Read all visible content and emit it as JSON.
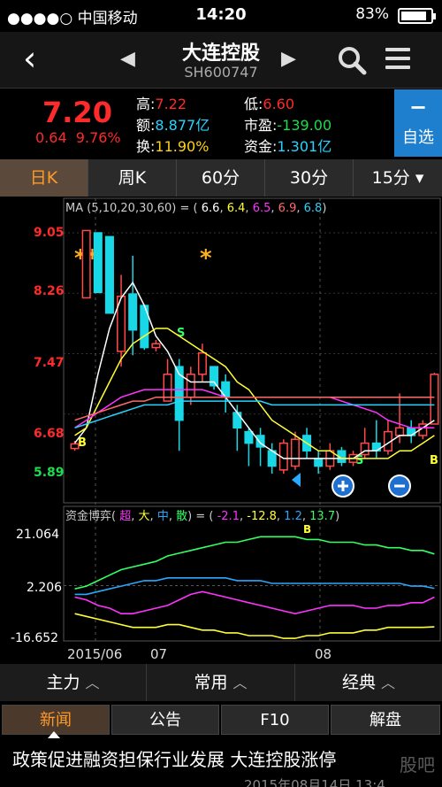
{
  "status_bar": {
    "carrier": "●●●●○ 中国移动",
    "time": "14:20",
    "battery": "83%"
  },
  "nav": {
    "title": "大连控股",
    "code": "SH600747"
  },
  "quote": {
    "price": "7.20",
    "change": "0.64",
    "change_pct": "9.76%",
    "high_label": "高:",
    "high": "7.22",
    "low_label": "低:",
    "low": "6.60",
    "amount_label": "额:",
    "amount": "8.877亿",
    "pe_label": "市盈:",
    "pe": "-139.00",
    "turnover_label": "换:",
    "turnover": "11.90%",
    "capital_label": "资金:",
    "capital": "1.301亿"
  },
  "add_watchlist": {
    "symbol": "−",
    "label": "自选"
  },
  "period_tabs": [
    "日K",
    "周K",
    "60分",
    "30分",
    "15分 ▾"
  ],
  "ma_header": {
    "label": "MA",
    "params": "(5,10,20,30,60)",
    "values": [
      "6.6",
      "6.4",
      "6.5",
      "6.9",
      "6.8"
    ],
    "colors": [
      "#ffffff",
      "#ffff33",
      "#ff33ff",
      "#33ff66",
      "#29d3ff"
    ]
  },
  "sub_header": {
    "label": "资金博弈",
    "names": [
      "超",
      "大",
      "中",
      "散"
    ],
    "values": [
      "-2.1",
      "-12.8",
      "1.2",
      "13.7"
    ],
    "colors": [
      "#ff33ff",
      "#ffff33",
      "#29a8ff",
      "#33ff66"
    ]
  },
  "chart_data": {
    "type": "candlestick",
    "price_ticks": [
      "9.05",
      "8.26",
      "7.47",
      "6.68",
      "5.89"
    ],
    "price_range": [
      5.89,
      9.05
    ],
    "sub_ticks": [
      "21.064",
      "2.206",
      "-16.652"
    ],
    "sub_range": [
      -16.652,
      21.064
    ],
    "x_labels": [
      "2015/06",
      "07",
      "08"
    ],
    "annotations": [
      "**",
      "*",
      "S",
      "S",
      "B",
      "B",
      "B"
    ],
    "candles": [
      {
        "o": 6.23,
        "c": 6.29,
        "h": 6.33,
        "l": 6.2
      },
      {
        "o": 8.2,
        "c": 9.08,
        "h": 9.08,
        "l": 8.2
      },
      {
        "o": 9.05,
        "c": 8.27,
        "h": 9.05,
        "l": 8.27
      },
      {
        "o": 9.0,
        "c": 8.0,
        "h": 9.0,
        "l": 8.0
      },
      {
        "o": 7.5,
        "c": 8.22,
        "h": 8.5,
        "l": 7.3
      },
      {
        "o": 8.25,
        "c": 7.78,
        "h": 8.75,
        "l": 7.45
      },
      {
        "o": 8.1,
        "c": 7.55,
        "h": 8.1,
        "l": 7.52
      },
      {
        "o": 7.55,
        "c": 7.6,
        "h": 7.65,
        "l": 7.5
      },
      {
        "o": 6.85,
        "c": 7.2,
        "h": 7.4,
        "l": 6.85
      },
      {
        "o": 7.3,
        "c": 6.6,
        "h": 7.4,
        "l": 6.2
      },
      {
        "o": 6.9,
        "c": 7.2,
        "h": 7.3,
        "l": 6.8
      },
      {
        "o": 7.2,
        "c": 7.48,
        "h": 7.6,
        "l": 7.1
      },
      {
        "o": 7.3,
        "c": 7.05,
        "h": 7.3,
        "l": 7.0
      },
      {
        "o": 7.1,
        "c": 6.9,
        "h": 7.2,
        "l": 6.7
      },
      {
        "o": 6.7,
        "c": 6.5,
        "h": 6.8,
        "l": 6.2
      },
      {
        "o": 6.45,
        "c": 6.3,
        "h": 6.5,
        "l": 6.0
      },
      {
        "o": 6.4,
        "c": 6.25,
        "h": 6.5,
        "l": 6.0
      },
      {
        "o": 6.2,
        "c": 6.0,
        "h": 6.3,
        "l": 5.9
      },
      {
        "o": 5.95,
        "c": 6.3,
        "h": 6.35,
        "l": 5.9
      },
      {
        "o": 6.0,
        "c": 6.35,
        "h": 6.45,
        "l": 5.95
      },
      {
        "o": 6.4,
        "c": 6.2,
        "h": 6.5,
        "l": 6.1
      },
      {
        "o": 6.1,
        "c": 6.0,
        "h": 6.2,
        "l": 5.9
      },
      {
        "o": 6.0,
        "c": 6.2,
        "h": 6.3,
        "l": 5.95
      },
      {
        "o": 6.2,
        "c": 6.05,
        "h": 6.25,
        "l": 6.0
      },
      {
        "o": 6.05,
        "c": 6.15,
        "h": 6.2,
        "l": 6.0
      },
      {
        "o": 6.15,
        "c": 6.3,
        "h": 6.5,
        "l": 6.1
      },
      {
        "o": 6.3,
        "c": 6.2,
        "h": 6.6,
        "l": 6.1
      },
      {
        "o": 6.2,
        "c": 6.45,
        "h": 6.6,
        "l": 6.15
      },
      {
        "o": 6.4,
        "c": 6.5,
        "h": 6.95,
        "l": 6.3
      },
      {
        "o": 6.5,
        "c": 6.4,
        "h": 6.6,
        "l": 6.3
      },
      {
        "o": 6.4,
        "c": 6.55,
        "h": 6.6,
        "l": 6.35
      },
      {
        "o": 6.55,
        "c": 7.2,
        "h": 7.22,
        "l": 6.55
      }
    ],
    "ma_lines": [
      {
        "name": "MA5",
        "values": [
          6.3,
          6.5,
          7.2,
          7.8,
          8.2,
          8.4,
          8.1,
          7.7,
          7.5,
          7.2,
          7.1,
          7.1,
          7.1,
          6.9,
          6.7,
          6.5,
          6.3,
          6.2,
          6.1,
          6.1,
          6.1,
          6.1,
          6.1,
          6.1,
          6.1,
          6.2,
          6.2,
          6.3,
          6.4,
          6.4,
          6.5,
          6.6
        ]
      },
      {
        "name": "MA10",
        "values": [
          6.4,
          6.5,
          6.8,
          7.1,
          7.4,
          7.6,
          7.7,
          7.8,
          7.8,
          7.7,
          7.6,
          7.5,
          7.4,
          7.3,
          7.1,
          7.0,
          6.8,
          6.6,
          6.5,
          6.4,
          6.3,
          6.2,
          6.2,
          6.1,
          6.1,
          6.1,
          6.1,
          6.1,
          6.2,
          6.2,
          6.3,
          6.4
        ]
      },
      {
        "name": "MA20",
        "values": [
          6.5,
          6.6,
          6.7,
          6.8,
          6.9,
          6.95,
          7.0,
          7.0,
          7.0,
          7.0,
          7.0,
          7.0,
          6.95,
          6.9,
          6.9,
          6.9,
          6.9,
          6.9,
          6.9,
          6.9,
          6.9,
          6.9,
          6.9,
          6.85,
          6.8,
          6.75,
          6.7,
          6.6,
          6.55,
          6.5,
          6.5,
          6.5
        ]
      },
      {
        "name": "MA30",
        "values": [
          6.6,
          6.65,
          6.7,
          6.75,
          6.8,
          6.85,
          6.85,
          6.9,
          6.9,
          6.9,
          6.9,
          6.9,
          6.9,
          6.9,
          6.9,
          6.9,
          6.9,
          6.9,
          6.9,
          6.9,
          6.9,
          6.9,
          6.9,
          6.9,
          6.9,
          6.9,
          6.9,
          6.9,
          6.9,
          6.9,
          6.9,
          6.9
        ]
      },
      {
        "name": "MA60",
        "values": [
          6.5,
          6.55,
          6.6,
          6.65,
          6.7,
          6.75,
          6.8,
          6.8,
          6.8,
          6.85,
          6.85,
          6.85,
          6.85,
          6.85,
          6.85,
          6.85,
          6.85,
          6.8,
          6.8,
          6.8,
          6.8,
          6.8,
          6.8,
          6.8,
          6.8,
          6.8,
          6.8,
          6.8,
          6.8,
          6.8,
          6.8,
          6.8
        ]
      }
    ],
    "sub_lines": [
      {
        "name": "超",
        "values": [
          -2,
          -3,
          -5,
          -6,
          -8,
          -8,
          -7,
          -6,
          -5,
          -3,
          -1,
          0,
          -1,
          -2,
          -3,
          -4,
          -5,
          -6,
          -7,
          -8,
          -7,
          -6,
          -5,
          -5,
          -5,
          -6,
          -6,
          -5,
          -5,
          -4,
          -4,
          -2
        ]
      },
      {
        "name": "大",
        "values": [
          -8,
          -9,
          -10,
          -11,
          -12,
          -13,
          -13,
          -13,
          -12,
          -12,
          -13,
          -14,
          -14,
          -15,
          -15,
          -16,
          -16,
          -16,
          -17,
          -17,
          -16,
          -16,
          -15,
          -15,
          -15,
          -14,
          -14,
          -13,
          -13,
          -13,
          -13,
          -12.8
        ]
      },
      {
        "name": "中",
        "values": [
          -1,
          -1,
          0,
          1,
          2,
          3,
          4,
          4,
          5,
          5,
          5,
          5,
          5,
          5,
          4,
          4,
          4,
          3,
          3,
          3,
          3,
          3,
          3,
          3,
          3,
          3,
          3,
          3,
          3,
          2,
          2,
          1.2
        ]
      },
      {
        "name": "散",
        "values": [
          1,
          2,
          4,
          6,
          8,
          9,
          10,
          11,
          13,
          14,
          15,
          16,
          17,
          18,
          18,
          19,
          20,
          20,
          20,
          20,
          19,
          19,
          18,
          18,
          18,
          17,
          17,
          16,
          16,
          15,
          15,
          13.7
        ]
      }
    ]
  },
  "function_bar": [
    {
      "label": "主力",
      "chev": "︿"
    },
    {
      "label": "常用",
      "chev": "︿"
    },
    {
      "label": "经典",
      "chev": "︿"
    }
  ],
  "news_tabs": [
    "新闻",
    "公告",
    "F10",
    "解盘"
  ],
  "news": {
    "headline": "政策促进融资担保行业发展 大连控股涨停",
    "sub": "2015年08月14日 13:4"
  },
  "watermark": "股吧"
}
